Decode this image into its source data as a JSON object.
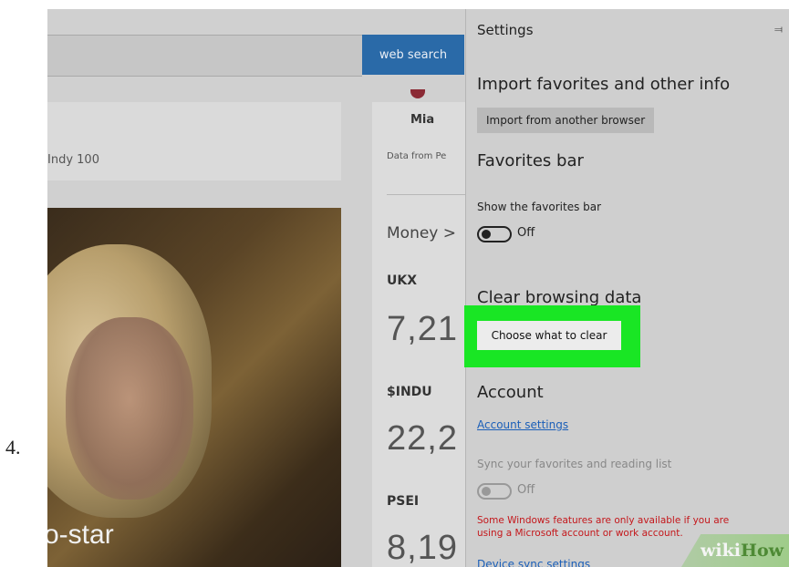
{
  "step_number": "4.",
  "browser_page": {
    "search_button": "web search",
    "card_text": "Indy 100",
    "profile_name": "Mia",
    "data_from": "Data from Pe",
    "money_label": "Money  >",
    "tickers": [
      {
        "symbol": "UKX",
        "value": "7,21"
      },
      {
        "symbol": "$INDU",
        "value": "22,2"
      },
      {
        "symbol": "PSEI",
        "value": "8,19"
      }
    ],
    "photo_caption": "o-star"
  },
  "settings": {
    "title": "Settings",
    "pin_icon": "pin-icon",
    "import_heading": "Import favorites and other info",
    "import_button": "Import from another browser",
    "favorites_heading": "Favorites bar",
    "show_favorites_label": "Show the favorites bar",
    "show_favorites_state": "Off",
    "clear_heading": "Clear browsing data",
    "clear_button": "Choose what to clear",
    "account_heading": "Account",
    "account_link": "Account settings",
    "sync_label": "Sync your favorites and reading list",
    "sync_state": "Off",
    "warning": "Some Windows features are only available if you are using a Microsoft account or work account.",
    "device_sync_link": "Device sync settings"
  },
  "watermark": {
    "part1": "wiki",
    "part2": "How"
  },
  "colors": {
    "highlight": "#19e624",
    "link": "#1b5fb8",
    "warning": "#c4171b",
    "search_button": "#2a6aa8"
  }
}
